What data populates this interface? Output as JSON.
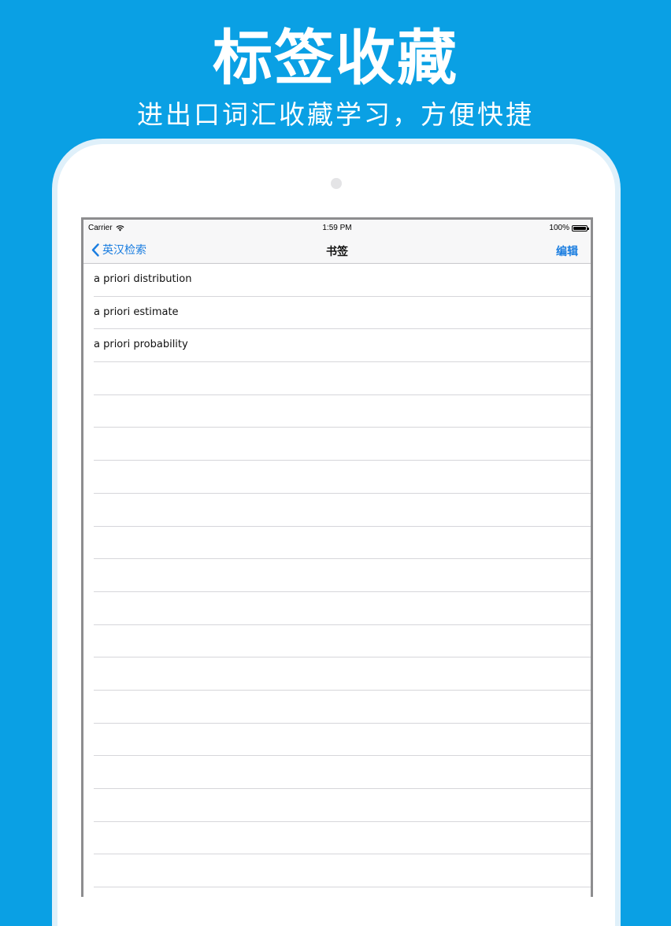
{
  "promo": {
    "headline": "标签收藏",
    "subline": "进出口词汇收藏学习，方便快捷"
  },
  "status_bar": {
    "carrier": "Carrier",
    "time": "1:59 PM",
    "battery": "100%"
  },
  "nav": {
    "back_label": "英汉检索",
    "title": "书签",
    "edit_label": "编辑"
  },
  "bookmarks": [
    {
      "label": "a priori distribution"
    },
    {
      "label": "a priori estimate"
    },
    {
      "label": "a priori probability"
    },
    {
      "label": ""
    },
    {
      "label": ""
    },
    {
      "label": ""
    },
    {
      "label": ""
    },
    {
      "label": ""
    },
    {
      "label": ""
    },
    {
      "label": ""
    },
    {
      "label": ""
    },
    {
      "label": ""
    },
    {
      "label": ""
    },
    {
      "label": ""
    },
    {
      "label": ""
    },
    {
      "label": ""
    },
    {
      "label": ""
    },
    {
      "label": ""
    },
    {
      "label": ""
    },
    {
      "label": ""
    }
  ],
  "colors": {
    "background": "#0aa0e4",
    "accent": "#1a7de0"
  }
}
